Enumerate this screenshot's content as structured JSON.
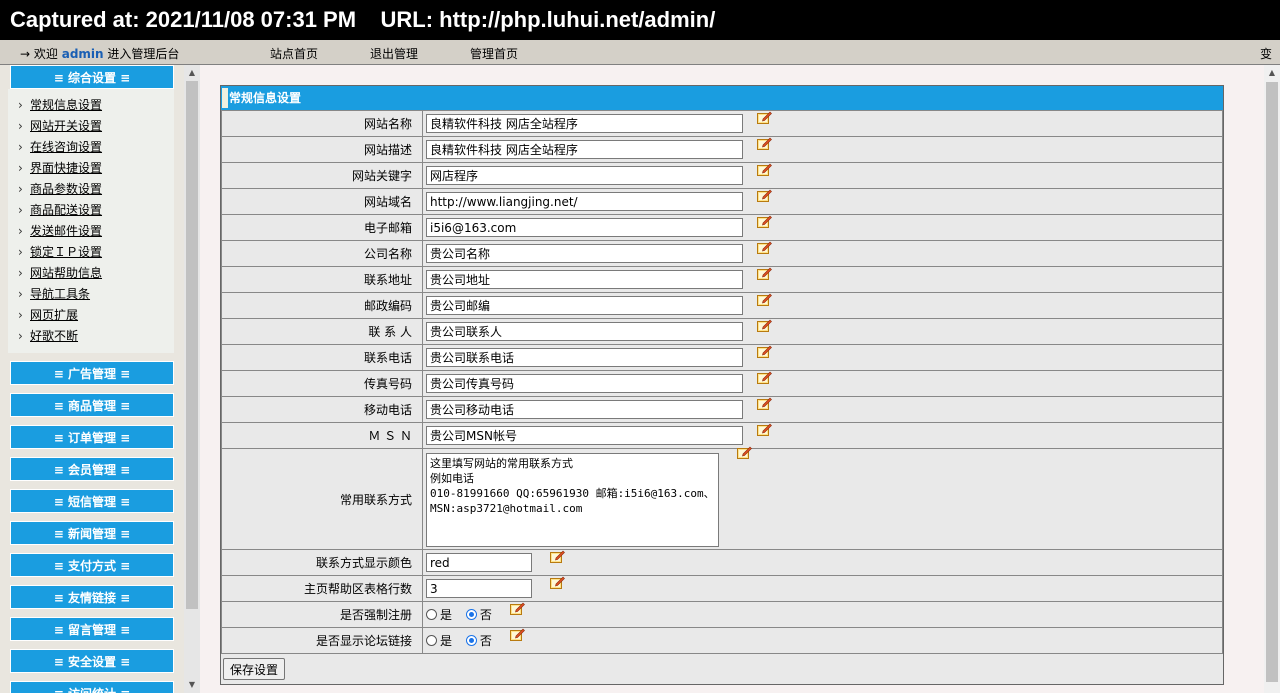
{
  "capture": {
    "text": "Captured at: 2021/11/08 07:31 PM    URL: http://php.luhui.net/admin/"
  },
  "topnav": {
    "arrow": "→",
    "welcome_pre": "欢迎",
    "user": "admin",
    "welcome_post": "进入管理后台",
    "links": [
      "站点首页",
      "退出管理",
      "管理首页"
    ],
    "edge": "变"
  },
  "sidebar": {
    "first_section": "≡ 综合设置 ≡",
    "items": [
      "常规信息设置",
      "网站开关设置",
      "在线咨询设置",
      "界面快捷设置",
      "商品参数设置",
      "商品配送设置",
      "发送邮件设置",
      "锁定ＩＰ设置",
      "网站帮助信息",
      "导航工具条",
      "网页扩展",
      "好歌不断"
    ],
    "sections": [
      "≡ 广告管理 ≡",
      "≡ 商品管理 ≡",
      "≡ 订单管理 ≡",
      "≡ 会员管理 ≡",
      "≡ 短信管理 ≡",
      "≡ 新闻管理 ≡",
      "≡ 支付方式 ≡",
      "≡ 友情链接 ≡",
      "≡ 留言管理 ≡",
      "≡ 安全设置 ≡",
      "≡ 访问统计 ≡"
    ]
  },
  "form": {
    "title": "常规信息设置",
    "fields": [
      {
        "label": "网站名称",
        "value": "良精软件科技 网店全站程序"
      },
      {
        "label": "网站描述",
        "value": "良精软件科技 网店全站程序"
      },
      {
        "label": "网站关键字",
        "value": "网店程序"
      },
      {
        "label": "网站域名",
        "value": "http://www.liangjing.net/"
      },
      {
        "label": "电子邮箱",
        "value": "i5i6@163.com"
      },
      {
        "label": "公司名称",
        "value": "贵公司名称"
      },
      {
        "label": "联系地址",
        "value": "贵公司地址"
      },
      {
        "label": "邮政编码",
        "value": "贵公司邮编"
      },
      {
        "label": "联 系 人",
        "value": "贵公司联系人"
      },
      {
        "label": "联系电话",
        "value": "贵公司联系电话"
      },
      {
        "label": "传真号码",
        "value": "贵公司传真号码"
      },
      {
        "label": "移动电话",
        "value": "贵公司移动电话"
      },
      {
        "label": "Ｍ Ｓ Ｎ",
        "value": "贵公司MSN帐号"
      }
    ],
    "contact": {
      "label": "常用联系方式",
      "value": "这里填写网站的常用联系方式\n例如电话\n010-81991660 QQ:65961930 邮箱:i5i6@163.com、MSN:asp3721@hotmail.com"
    },
    "color_field": {
      "label": "联系方式显示颜色",
      "value": "red"
    },
    "rows_field": {
      "label": "主页帮助区表格行数",
      "value": "3"
    },
    "force_register": {
      "label": "是否强制注册",
      "yes": "是",
      "no": "否",
      "selected": "no"
    },
    "show_forum": {
      "label": "是否显示论坛链接",
      "yes": "是",
      "no": "否",
      "selected": "no"
    },
    "save_label": "保存设置"
  },
  "icons": {
    "edit": "edit-note-icon"
  },
  "colors": {
    "accent": "#1a9de0",
    "frame": "#d4d0c8",
    "main_bg": "#f7f1f1"
  }
}
